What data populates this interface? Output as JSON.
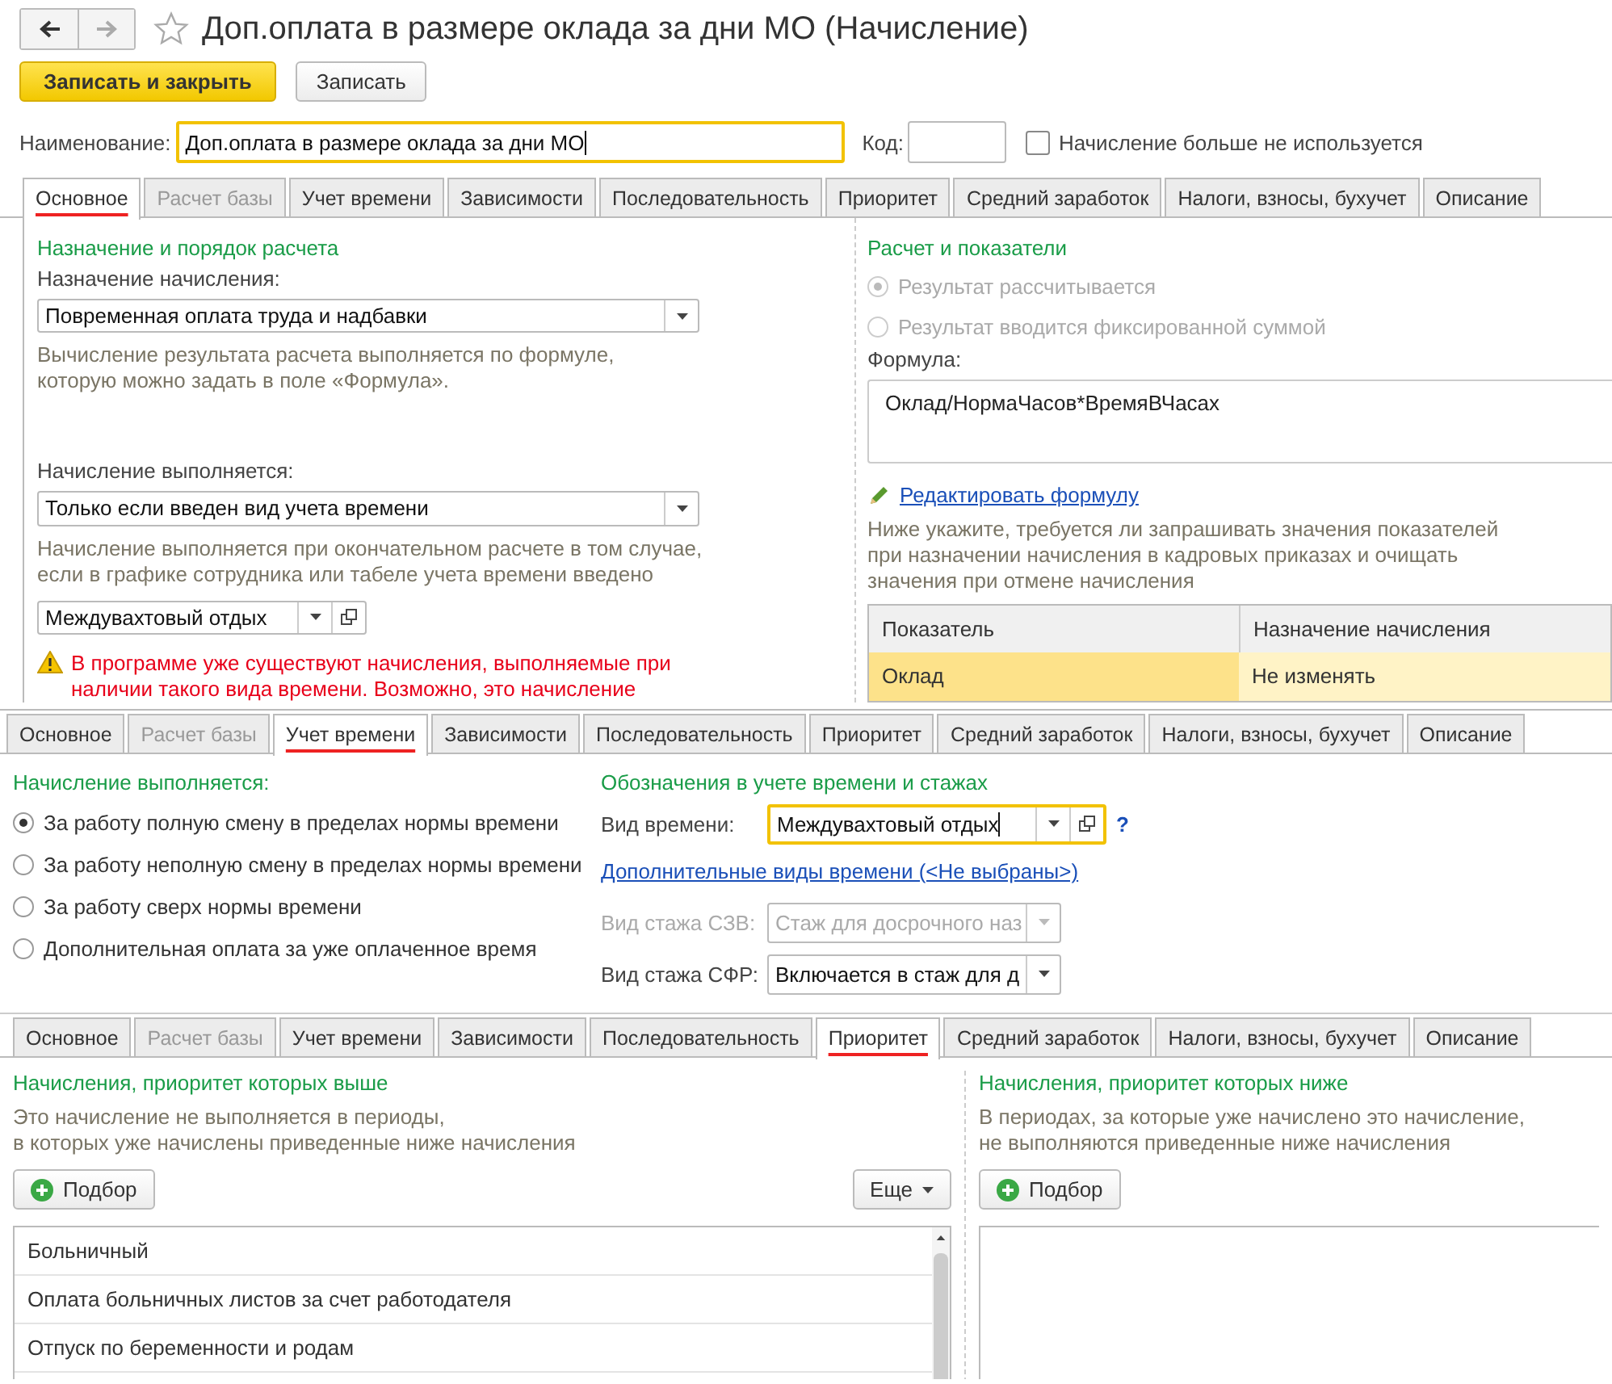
{
  "window": {
    "title": "Доп.оплата в размере оклада за дни МО (Начисление)"
  },
  "toolbar": [
    {
      "label": "Записать и закрыть",
      "kind": "primary"
    },
    {
      "label": "Записать",
      "kind": "default"
    }
  ],
  "name_field": {
    "label": "Наименование:",
    "value": "Доп.оплата в размере оклада за дни МО",
    "focused": true
  },
  "code_field": {
    "label": "Код:"
  },
  "not_used": {
    "label": "Начисление больше не используется",
    "checked": false
  },
  "panels": [
    {
      "kind": "main",
      "tabs": [
        {
          "label": "Основное",
          "selected": true,
          "disabled": false
        },
        {
          "label": "Расчет базы",
          "selected": false,
          "disabled": true
        },
        {
          "label": "Учет времени",
          "selected": false,
          "disabled": false
        },
        {
          "label": "Зависимости",
          "selected": false,
          "disabled": false
        },
        {
          "label": "Последовательность",
          "selected": false,
          "disabled": false
        },
        {
          "label": "Приоритет",
          "selected": false,
          "disabled": false
        },
        {
          "label": "Средний заработок",
          "selected": false,
          "disabled": false
        },
        {
          "label": "Налоги, взносы, бухучет",
          "selected": false,
          "disabled": false
        },
        {
          "label": "Описание",
          "selected": false,
          "disabled": false
        }
      ],
      "left": {
        "title": "Назначение и порядок расчета",
        "assignment_label": "Назначение начисления:",
        "assignment_value": "Повременная оплата труда и надбавки",
        "assignment_hint": "Вычисление результата расчета выполняется по формуле,\nкоторую можно задать в поле «Формула».",
        "execution_label": "Начисление выполняется:",
        "execution_value": "Только если введен вид учета времени",
        "execution_hint": "Начисление выполняется при окончательном расчете в том случае,\nесли в графике сотрудника или табеле учета времени введено",
        "time_type_value": "Междувахтовый отдых",
        "warning": "В программе уже существуют начисления, выполняемые при\nналичии такого вида времени. Возможно, это начисление"
      },
      "right": {
        "title": "Расчет и показатели",
        "radios": [
          {
            "label": "Результат рассчитывается",
            "selected": true,
            "disabled": true
          },
          {
            "label": "Результат вводится фиксированной суммой",
            "selected": false,
            "disabled": true
          }
        ],
        "formula_label": "Формула:",
        "formula_value": "Оклад/НормаЧасов*ВремяВЧасах",
        "edit_link": "Редактировать формулу",
        "hint": "Ниже укажите, требуется ли запрашивать значения показателей\nпри назначении начисления в кадровых приказах и очищать\nзначения при отмене начисления",
        "columns": [
          "Показатель",
          "Назначение начисления"
        ],
        "rows": [
          {
            "cells": [
              "Оклад",
              "Не изменять"
            ],
            "selected": true
          }
        ]
      }
    },
    {
      "kind": "time",
      "tabs": [
        {
          "label": "Основное",
          "selected": false,
          "disabled": false
        },
        {
          "label": "Расчет базы",
          "selected": false,
          "disabled": true
        },
        {
          "label": "Учет времени",
          "selected": true,
          "disabled": false
        },
        {
          "label": "Зависимости",
          "selected": false,
          "disabled": false
        },
        {
          "label": "Последовательность",
          "selected": false,
          "disabled": false
        },
        {
          "label": "Приоритет",
          "selected": false,
          "disabled": false
        },
        {
          "label": "Средний заработок",
          "selected": false,
          "disabled": false
        },
        {
          "label": "Налоги, взносы, бухучет",
          "selected": false,
          "disabled": false
        },
        {
          "label": "Описание",
          "selected": false,
          "disabled": false
        }
      ],
      "left": {
        "title": "Начисление выполняется:",
        "radios": [
          {
            "label": "За работу полную смену в пределах нормы времени",
            "selected": true
          },
          {
            "label": "За работу неполную смену в пределах нормы времени",
            "selected": false
          },
          {
            "label": "За работу сверх нормы времени",
            "selected": false
          },
          {
            "label": "Дополнительная оплата за уже оплаченное время",
            "selected": false
          }
        ]
      },
      "right": {
        "title": "Обозначения в учете времени и стажах",
        "time_label": "Вид времени:",
        "time_value": "Междувахтовый отдых",
        "time_focused": true,
        "help": "?",
        "link": "Дополнительные виды времени (<Не выбраны>)",
        "fields": [
          {
            "label": "Вид стажа СЗВ:",
            "value": "Стаж для досрочного наз",
            "disabled": true
          },
          {
            "label": "Вид стажа СФР:",
            "value": "Включается в стаж для д",
            "disabled": false
          }
        ]
      }
    },
    {
      "kind": "priority",
      "tabs": [
        {
          "label": "Основное",
          "selected": false,
          "disabled": false
        },
        {
          "label": "Расчет базы",
          "selected": false,
          "disabled": true
        },
        {
          "label": "Учет времени",
          "selected": false,
          "disabled": false
        },
        {
          "label": "Зависимости",
          "selected": false,
          "disabled": false
        },
        {
          "label": "Последовательность",
          "selected": false,
          "disabled": false
        },
        {
          "label": "Приоритет",
          "selected": true,
          "disabled": false
        },
        {
          "label": "Средний заработок",
          "selected": false,
          "disabled": false
        },
        {
          "label": "Налоги, взносы, бухучет",
          "selected": false,
          "disabled": false
        },
        {
          "label": "Описание",
          "selected": false,
          "disabled": false
        }
      ],
      "left": {
        "title": "Начисления, приоритет которых выше",
        "hint": "Это начисление не выполняется в периоды,\nв которых уже начислены приведенные ниже начисления",
        "add": "Подбор",
        "more": "Еще",
        "items": [
          "Больничный",
          "Оплата больничных листов за счет работодателя",
          "Отпуск по беременности и родам"
        ]
      },
      "right": {
        "title": "Начисления, приоритет которых ниже",
        "hint": "В периодах, за которые уже начислено это начисление,\nне выполняются приведенные ниже начисления",
        "add": "Подбор"
      }
    }
  ]
}
